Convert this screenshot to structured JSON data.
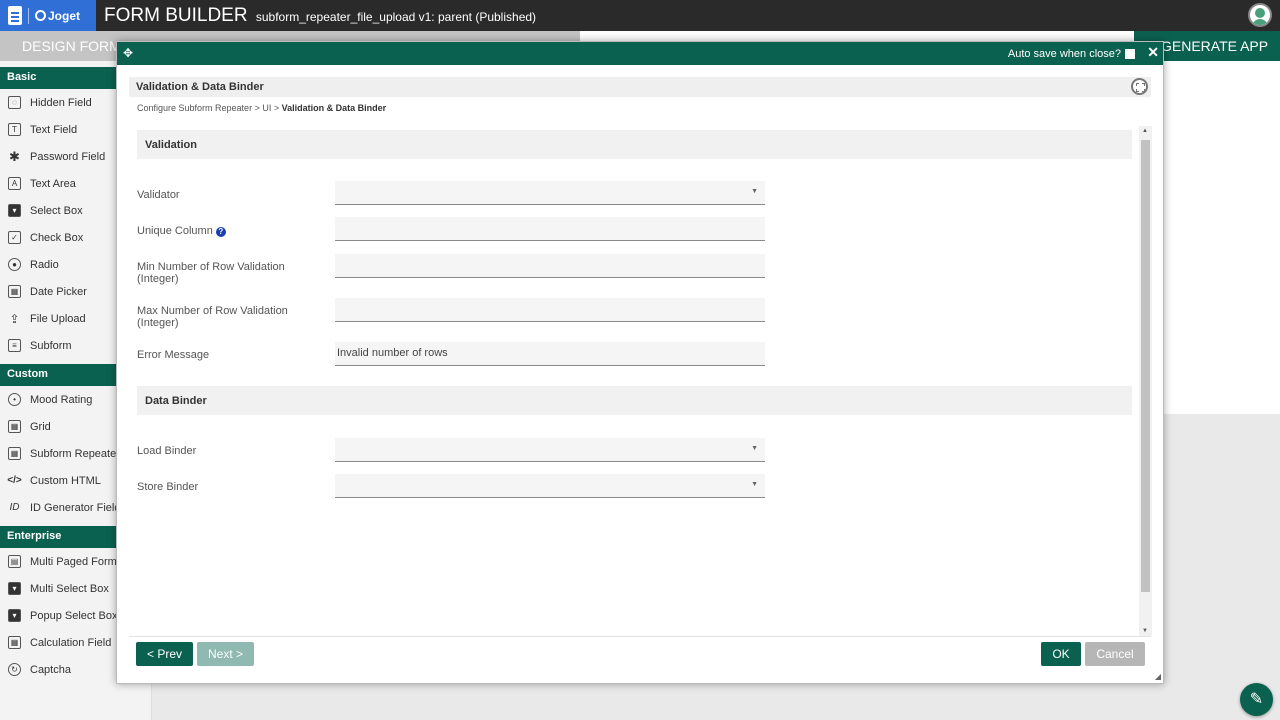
{
  "topbar": {
    "logo_text": "Joget",
    "title": "FORM BUILDER",
    "subtitle": "subform_repeater_file_upload v1: parent (Published)"
  },
  "subbar": {
    "design_tab": "DESIGN FORM",
    "generate_app": "GENERATE APP"
  },
  "palette": {
    "sections": [
      {
        "title": "Basic",
        "items": [
          {
            "label": "Hidden Field",
            "icon": "hidden-icon"
          },
          {
            "label": "Text Field",
            "icon": "text-field-icon"
          },
          {
            "label": "Password Field",
            "icon": "asterisk-icon"
          },
          {
            "label": "Text Area",
            "icon": "text-area-icon"
          },
          {
            "label": "Select Box",
            "icon": "select-box-icon"
          },
          {
            "label": "Check Box",
            "icon": "check-box-icon"
          },
          {
            "label": "Radio",
            "icon": "radio-icon"
          },
          {
            "label": "Date Picker",
            "icon": "calendar-icon"
          },
          {
            "label": "File Upload",
            "icon": "upload-icon"
          },
          {
            "label": "Subform",
            "icon": "subform-icon"
          }
        ]
      },
      {
        "title": "Custom",
        "items": [
          {
            "label": "Mood Rating",
            "icon": "mood-icon"
          },
          {
            "label": "Grid",
            "icon": "grid-icon"
          },
          {
            "label": "Subform Repeater",
            "icon": "repeater-icon"
          },
          {
            "label": "Custom HTML",
            "icon": "code-icon"
          },
          {
            "label": "ID Generator Field",
            "icon": "id-icon"
          }
        ]
      },
      {
        "title": "Enterprise",
        "items": [
          {
            "label": "Multi Paged Form",
            "icon": "pages-icon"
          },
          {
            "label": "Multi Select Box",
            "icon": "multi-select-icon"
          },
          {
            "label": "Popup Select Box",
            "icon": "popup-select-icon"
          },
          {
            "label": "Calculation Field",
            "icon": "calculator-icon"
          },
          {
            "label": "Captcha",
            "icon": "captcha-icon"
          }
        ]
      }
    ]
  },
  "dialog": {
    "autosave_label": "Auto save when close?",
    "panel_title": "Validation & Data Binder",
    "breadcrumb": {
      "parts": "Configure Subform Repeater > UI > ",
      "current": "Validation & Data Binder"
    },
    "validation": {
      "heading": "Validation",
      "validator_label": "Validator",
      "validator_value": "",
      "unique_column_label": "Unique Column",
      "unique_column_value": "",
      "min_rows_label": "Min Number of Row Validation (Integer)",
      "min_rows_value": "",
      "max_rows_label": "Max Number of Row Validation (Integer)",
      "max_rows_value": "",
      "error_message_label": "Error Message",
      "error_message_value": "Invalid number of rows"
    },
    "data_binder": {
      "heading": "Data Binder",
      "load_binder_label": "Load Binder",
      "load_binder_value": "",
      "store_binder_label": "Store Binder",
      "store_binder_value": ""
    },
    "buttons": {
      "prev": "< Prev",
      "next": "Next >",
      "ok": "OK",
      "cancel": "Cancel"
    }
  }
}
